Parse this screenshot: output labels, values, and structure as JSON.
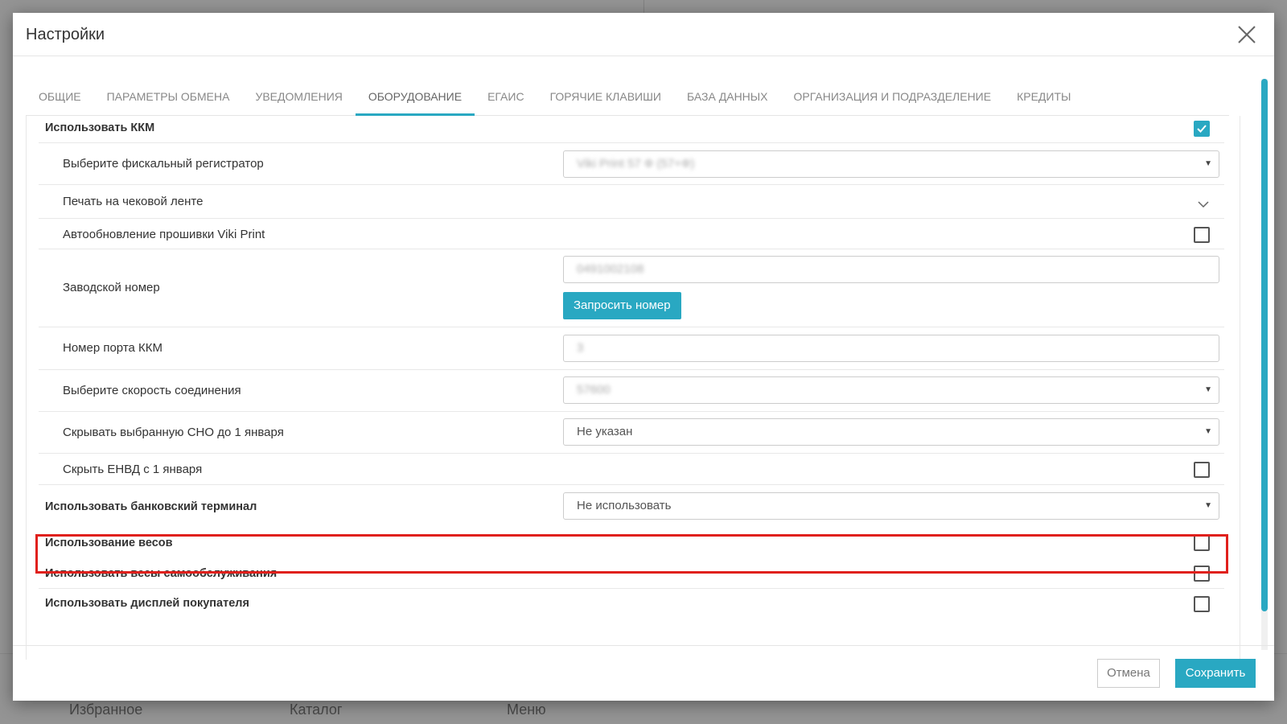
{
  "background": {
    "nav": [
      "Избранное",
      "Каталог",
      "Меню"
    ]
  },
  "modal": {
    "title": "Настройки",
    "tabs": [
      "ОБЩИЕ",
      "ПАРАМЕТРЫ ОБМЕНА",
      "УВЕДОМЛЕНИЯ",
      "ОБОРУДОВАНИЕ",
      "ЕГАИС",
      "ГОРЯЧИЕ КЛАВИШИ",
      "БАЗА ДАННЫХ",
      "ОРГАНИЗАЦИЯ И ПОДРАЗДЕЛЕНИЕ",
      "КРЕДИТЫ"
    ],
    "active_tab": "ОБОРУДОВАНИЕ"
  },
  "settings": {
    "use_kkm": {
      "label": "Использовать ККМ",
      "checked": true
    },
    "fiscal_registrar": {
      "label": "Выберите фискальный регистратор",
      "value": "Viki Print 57 Ф (57+Ф)"
    },
    "receipt_print": {
      "label": "Печать на чековой ленте"
    },
    "firmware_update": {
      "label": "Автообновление прошивки Viki Print",
      "checked": false
    },
    "serial_number": {
      "label": "Заводской номер",
      "value": "0491002108",
      "button": "Запросить номер"
    },
    "kkm_port": {
      "label": "Номер порта ККМ",
      "value": "3"
    },
    "connection_speed": {
      "label": "Выберите скорость соединения",
      "value": "57600"
    },
    "hide_sno": {
      "label": "Скрывать выбранную СНО до 1 января",
      "value": "Не указан"
    },
    "hide_envd": {
      "label": "Скрыть ЕНВД с 1 января",
      "checked": false
    },
    "bank_terminal": {
      "label": "Использовать банковский терминал",
      "value": "Не использовать"
    },
    "scales": {
      "label": "Использование весов",
      "checked": false
    },
    "self_service_scales": {
      "label": "Использовать весы самообслуживания",
      "checked": false
    },
    "customer_display": {
      "label": "Использовать дисплей покупателя",
      "checked": false
    }
  },
  "footer": {
    "cancel": "Отмена",
    "save": "Сохранить"
  },
  "colors": {
    "accent": "#29a8c2",
    "highlight": "#e0201c"
  }
}
